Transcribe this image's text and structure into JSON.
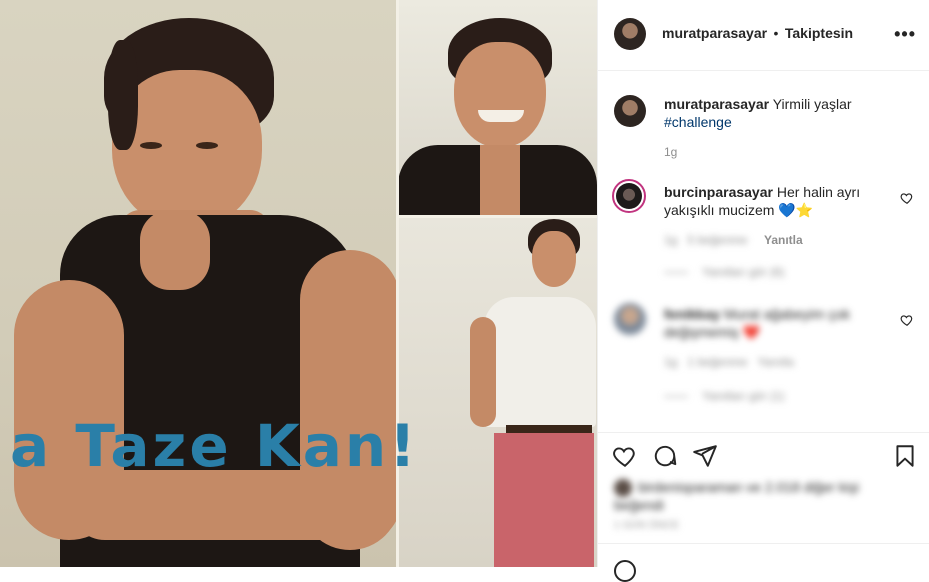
{
  "post": {
    "image_headline": "a Taze Kan!"
  },
  "header": {
    "username": "muratparasayar",
    "separator": "•",
    "follow_status": "Takiptesin",
    "more_icon": "more-dots-icon"
  },
  "caption": {
    "username": "muratparasayar",
    "text": "Yirmili yaşlar",
    "hashtag": "#challenge",
    "time": "1g"
  },
  "comments": [
    {
      "username": "burcinparasayar",
      "text": "Her halin ayrı yakışıklı mucizem 💙⭐",
      "time": "1g",
      "likes": "5 beğenme",
      "reply": "Yanıtla",
      "view_replies": "Yanıtları gör (6)"
    },
    {
      "username": "fenikkay",
      "text": "Murat ağabeyim çok değişmemiş",
      "heart": "❤️",
      "time": "1g",
      "likes": "1 beğenme",
      "reply": "Yanıtla",
      "view_replies": "Yanıtları gör (1)"
    }
  ],
  "actions": {
    "like_icon": "heart-icon",
    "comment_icon": "comment-icon",
    "share_icon": "share-icon",
    "save_icon": "bookmark-icon"
  },
  "likes_line": "birdenisparaman ve 2.018 diğer kişi beğendi",
  "date": "1 GÜN ÖNCE",
  "colors": {
    "hashtag": "#00376b",
    "story_ring": "#c1347f",
    "headline": "#2a7fa8",
    "heart": "#ed4956"
  }
}
